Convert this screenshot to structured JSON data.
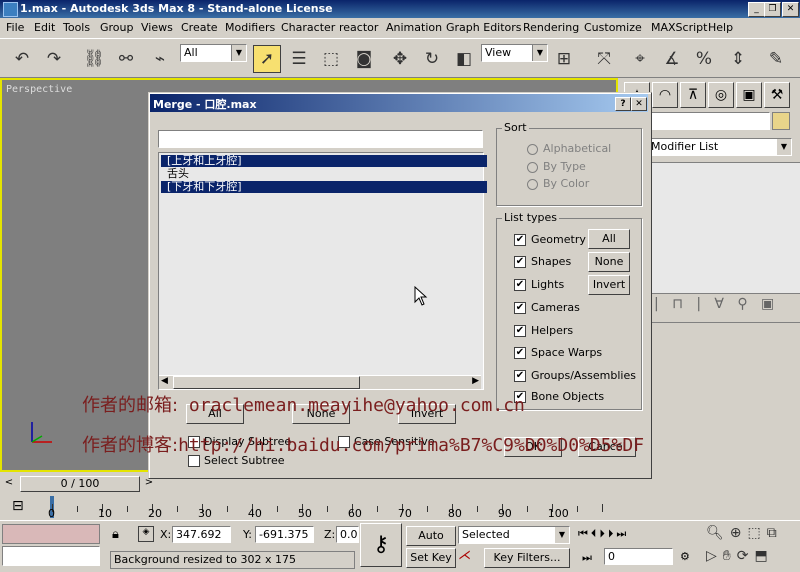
{
  "window": {
    "title": "1.max - Autodesk 3ds Max 8  - Stand-alone License",
    "buttons": [
      "_",
      "❐",
      "✕"
    ]
  },
  "menu": [
    "File",
    "Edit",
    "Tools",
    "Group",
    "Views",
    "Create",
    "Modifiers",
    "Character",
    "reactor",
    "Animation",
    "Graph Editors",
    "Rendering",
    "Customize",
    "MAXScript",
    "Help"
  ],
  "toolbar": {
    "selection_filter": "All",
    "ref_coord": "View"
  },
  "viewport": {
    "label": "Perspective"
  },
  "dialog": {
    "title": "Merge - 口腔.max",
    "help": "?",
    "close": "✕",
    "filter_value": "",
    "objects": [
      {
        "label": "[上牙和上牙腔]",
        "selected": true
      },
      {
        "label": "舌头",
        "selected": false
      },
      {
        "label": "[下牙和下牙腔]",
        "selected": true
      }
    ],
    "buttons": {
      "all": "All",
      "none": "None",
      "invert": "Invert",
      "ok": "OK",
      "cancel": "Cancel"
    },
    "checks": {
      "display_subtree": "Display Subtree",
      "case_sensitive": "Case Sensitive",
      "select_subtree": "Select Subtree"
    },
    "sort": {
      "title": "Sort",
      "options": [
        "Alphabetical",
        "By Type",
        "By Color"
      ]
    },
    "list_types": {
      "title": "List types",
      "items": [
        "Geometry",
        "Shapes",
        "Lights",
        "Cameras",
        "Helpers",
        "Space Warps",
        "Groups/Assemblies",
        "Bone Objects"
      ],
      "all": "All",
      "none": "None",
      "invert": "Invert"
    }
  },
  "panel": {
    "modifier_list": "Modifier List"
  },
  "watermark": {
    "line1_label": "作者的邮箱:",
    "line1_value": "oraclemean.meayihe@yahoo.com.cn",
    "line2_label": "作者的博客:",
    "line2_value": "http://hi.baidu.com/prima%B7%C9%D0%D0%D5%DF"
  },
  "timeline": {
    "frame": "0 / 100",
    "ticks": [
      "0",
      "10",
      "20",
      "30",
      "40",
      "50",
      "60",
      "70",
      "80",
      "90",
      "100"
    ]
  },
  "status": {
    "x_label": "X:",
    "x": "347.692",
    "y_label": "Y:",
    "y": "-691.375",
    "z_label": "Z:",
    "z": "0.0",
    "autokey": "Auto Key",
    "setkey": "Set Key",
    "selected": "Selected",
    "keyfilters": "Key Filters...",
    "frame": "0",
    "prompt": "Background resized to 302 x 175"
  }
}
